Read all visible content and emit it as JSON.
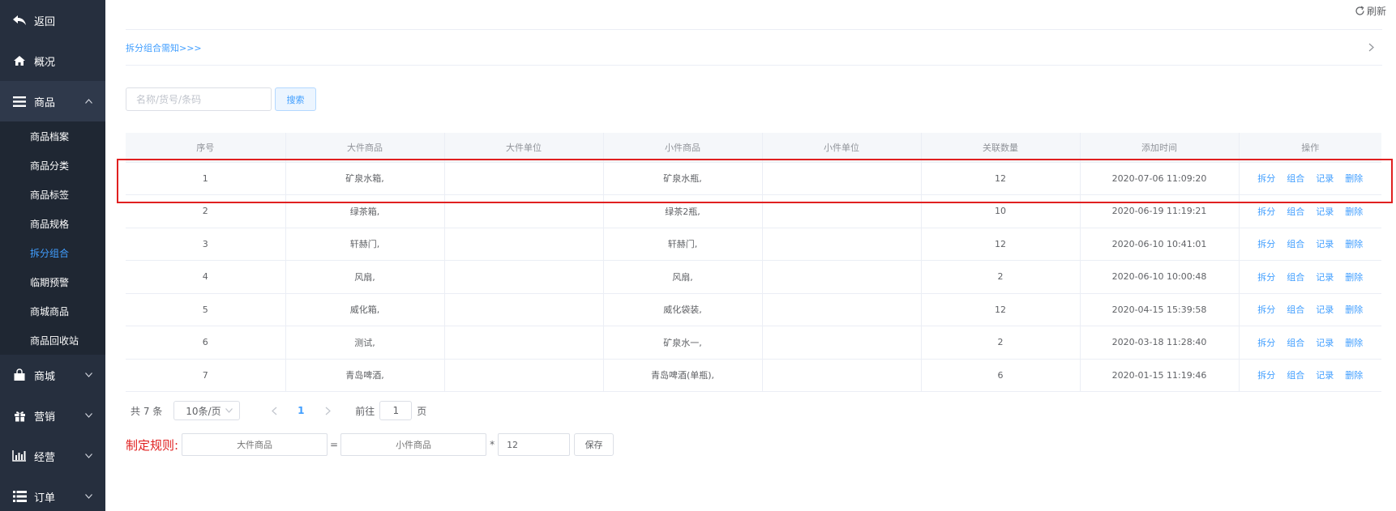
{
  "sidebar": {
    "back": {
      "label": "返回",
      "icon": "back-arrow-icon"
    },
    "overview": {
      "label": "概况",
      "icon": "home-icon"
    },
    "goods": {
      "label": "商品",
      "icon": "menu-lines-icon",
      "items": [
        {
          "label": "商品档案"
        },
        {
          "label": "商品分类"
        },
        {
          "label": "商品标签"
        },
        {
          "label": "商品规格"
        },
        {
          "label": "拆分组合",
          "active": true
        },
        {
          "label": "临期预警"
        },
        {
          "label": "商城商品"
        },
        {
          "label": "商品回收站"
        }
      ]
    },
    "mall": {
      "label": "商城",
      "icon": "shopping-bag-icon"
    },
    "marketing": {
      "label": "营销",
      "icon": "gift-icon"
    },
    "operation": {
      "label": "经营",
      "icon": "bar-chart-icon"
    },
    "orders": {
      "label": "订单",
      "icon": "list-icon"
    }
  },
  "header": {
    "refresh_label": "刷新"
  },
  "notice": {
    "link": "拆分组合需知>>>"
  },
  "search": {
    "placeholder": "名称/货号/条码",
    "button": "搜索"
  },
  "table": {
    "columns": [
      "序号",
      "大件商品",
      "大件单位",
      "小件商品",
      "小件单位",
      "关联数量",
      "添加时间",
      "操作"
    ],
    "rows": [
      {
        "no": "1",
        "big": "矿泉水箱,",
        "big_unit": "",
        "small": "矿泉水瓶,",
        "small_unit": "",
        "qty": "12",
        "time": "2020-07-06 11:09:20"
      },
      {
        "no": "2",
        "big": "绿茶箱,",
        "big_unit": "",
        "small": "绿茶2瓶,",
        "small_unit": "",
        "qty": "10",
        "time": "2020-06-19 11:19:21"
      },
      {
        "no": "3",
        "big": "轩赫门,",
        "big_unit": "",
        "small": "轩赫门,",
        "small_unit": "",
        "qty": "12",
        "time": "2020-06-10 10:41:01"
      },
      {
        "no": "4",
        "big": "风扇,",
        "big_unit": "",
        "small": "风扇,",
        "small_unit": "",
        "qty": "2",
        "time": "2020-06-10 10:00:48"
      },
      {
        "no": "5",
        "big": "威化箱,",
        "big_unit": "",
        "small": "威化袋装,",
        "small_unit": "",
        "qty": "12",
        "time": "2020-04-15 15:39:58"
      },
      {
        "no": "6",
        "big": "测试,",
        "big_unit": "",
        "small": "矿泉水一,",
        "small_unit": "",
        "qty": "2",
        "time": "2020-03-18 11:28:40"
      },
      {
        "no": "7",
        "big": "青岛啤酒,",
        "big_unit": "",
        "small": "青岛啤酒(单瓶),",
        "small_unit": "",
        "qty": "6",
        "time": "2020-01-15 11:19:46"
      }
    ],
    "actions": [
      "拆分",
      "组合",
      "记录",
      "删除"
    ]
  },
  "pagination": {
    "total": "共 7 条",
    "page_size": "10条/页",
    "current": "1",
    "goto_prefix": "前往",
    "goto_value": "1",
    "goto_suffix": "页"
  },
  "rule": {
    "label": "制定规则:",
    "big_placeholder": "大件商品",
    "equals": "=",
    "small_placeholder": "小件商品",
    "times": "*",
    "qty_value": "12",
    "save": "保存"
  },
  "colors": {
    "sidebar_bg": "#262f3e",
    "accent": "#409eff",
    "highlight": "#e02020"
  }
}
